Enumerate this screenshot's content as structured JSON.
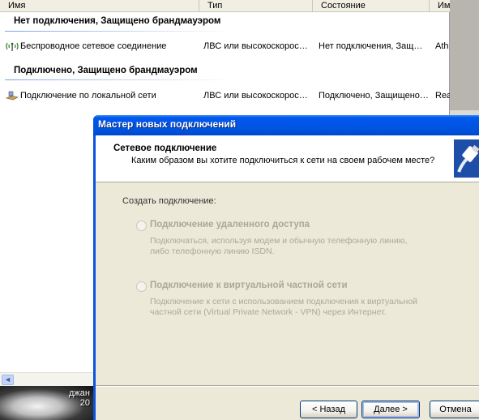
{
  "explorer": {
    "columns": [
      "Имя",
      "Тип",
      "Состояние",
      "Имя"
    ],
    "groups": [
      {
        "title": "Нет подключения, Защищено брандмауэром",
        "row": {
          "name": "Беспроводное сетевое соединение",
          "type": "ЛВС или высокоскорос…",
          "state": "Нет подключения, Защ…",
          "device": "Ath"
        }
      },
      {
        "title": "Подключено, Защищено брандмауэром",
        "row": {
          "name": "Подключение по локальной сети",
          "type": "ЛВС или высокоскорос…",
          "state": "Подключено, Защищено…",
          "device": "Rea"
        }
      }
    ],
    "scroll_left_arrow": "◄"
  },
  "desktop": {
    "line1": "джан",
    "line2": "20"
  },
  "wizard": {
    "title": "Мастер новых подключений",
    "header_title": "Сетевое подключение",
    "header_subtitle": "Каким образом вы хотите подключиться к сети на своем рабочем месте?",
    "create_label": "Создать подключение:",
    "options": [
      {
        "title": "Подключение удаленного доступа",
        "desc_line1": "Подключаться, используя модем и обычную телефонную линию,",
        "desc_line2": "либо телефонную линию ISDN."
      },
      {
        "title": "Подключение к виртуальной частной сети",
        "desc_line1": "Подключение к сети с использованием подключения к виртуальной",
        "desc_line2": "частной сети (Virtual Private Network - VPN) через Интернет."
      }
    ],
    "buttons": {
      "back": "< Назад",
      "next": "Далее >",
      "cancel": "Отмена"
    }
  },
  "colors": {
    "titlebar_blue": "#0055e5",
    "disabled_text": "#aca899",
    "dialog_face": "#ece9d8"
  }
}
